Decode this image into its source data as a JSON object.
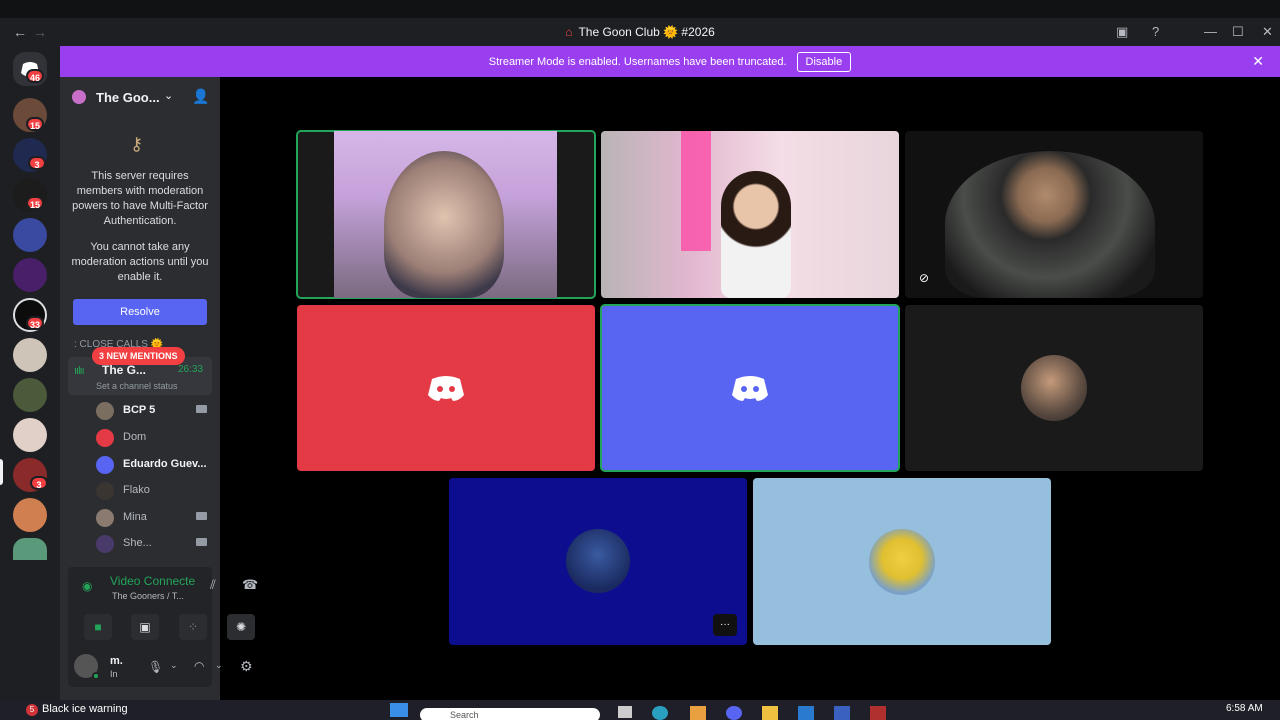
{
  "window": {
    "title": "The Goon Club 🌞 #2026",
    "back_icon": "←",
    "forward_icon": "→"
  },
  "banner": {
    "text": "Streamer Mode is enabled. Usernames have been truncated.",
    "button": "Disable",
    "close": "✕"
  },
  "rail": {
    "badges": [
      "46",
      "15",
      "3",
      "15",
      "33",
      "3"
    ]
  },
  "server": {
    "name": "The Goo...",
    "mfa_text_1": "This server requires members with moderation powers to have Multi-Factor Authentication.",
    "mfa_text_2": "You cannot take any moderation actions until you enable it.",
    "resolve": "Resolve",
    "category": ": CLOSE CALLS 🌞",
    "mentions": "3 NEW MENTIONS"
  },
  "voice_channel": {
    "name": "The G...",
    "time": "26:33",
    "status": "Set a channel status"
  },
  "voice_users": [
    {
      "name": "BCP 5",
      "bold": true
    },
    {
      "name": "Dom",
      "bold": false
    },
    {
      "name": "Eduardo Guev...",
      "bold": true
    },
    {
      "name": "Flako",
      "bold": false
    },
    {
      "name": "Mina",
      "bold": false
    },
    {
      "name": "She...",
      "bold": false
    }
  ],
  "voice_panel": {
    "status": "Video Connecte",
    "location": "The Gooners / T..."
  },
  "user": {
    "name": "m.",
    "status": "In"
  },
  "tiles": {
    "more": "···"
  },
  "taskbar": {
    "weather_badge": "5",
    "weather": "Black ice warning",
    "search": "Search",
    "time": "6:58 AM"
  },
  "colors": {
    "accent": "#5865f2",
    "banner": "#9a3ff0",
    "speaking": "#23a559",
    "red_tile": "#e33a45",
    "blue_tile": "#5865f2",
    "navy_tile": "#0d0d8f",
    "sky_tile": "#95bfdc"
  }
}
